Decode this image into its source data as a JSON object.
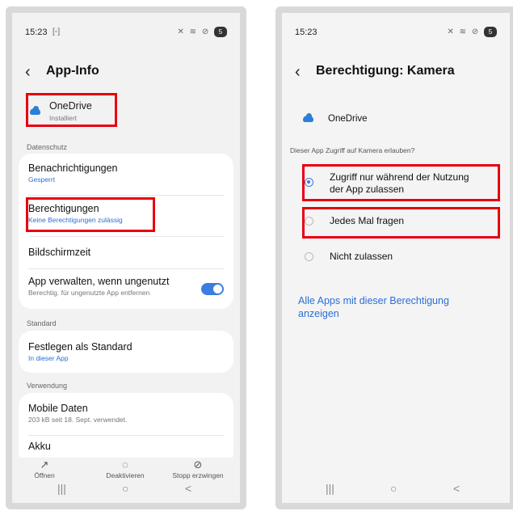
{
  "left": {
    "status": {
      "time": "15:23",
      "notif_icon": "screenshot-icon",
      "right_icons": "✕ ≋ ⊘",
      "battery": "5"
    },
    "header": {
      "title": "App-Info"
    },
    "app": {
      "name": "OneDrive",
      "status": "Installiert"
    },
    "sections": {
      "datenschutz": "Datenschutz",
      "standard": "Standard",
      "verwendung": "Verwendung"
    },
    "rows": {
      "notifications": {
        "title": "Benachrichtigungen",
        "sub": "Gesperrt"
      },
      "permissions": {
        "title": "Berechtigungen",
        "sub": "Keine Berechtigungen zulässig"
      },
      "screen_time": {
        "title": "Bildschirmzeit"
      },
      "manage_unused": {
        "title": "App verwalten, wenn ungenutzt",
        "sub": "Berechtig. für ungenutzte App entfernen"
      },
      "default": {
        "title": "Festlegen als Standard",
        "sub": "In dieser App"
      },
      "mobile_data": {
        "title": "Mobile Daten",
        "sub": "203 kB seit 18. Sept. verwendet."
      },
      "battery": {
        "title": "Akku"
      }
    },
    "actions": [
      {
        "label": "Öffnen",
        "icon": "open-external-icon"
      },
      {
        "label": "Deaktivieren",
        "icon": "disable-icon"
      },
      {
        "label": "Stopp erzwingen",
        "icon": "force-stop-icon"
      }
    ]
  },
  "right": {
    "status": {
      "time": "15:23",
      "right_icons": "✕ ≋ ⊘",
      "battery": "5"
    },
    "header": {
      "title": "Berechtigung: Kamera"
    },
    "app": {
      "name": "OneDrive"
    },
    "question": "Dieser App Zugriff auf Kamera erlauben?",
    "options": [
      {
        "label": "Zugriff nur während der Nutzung der App zulassen",
        "selected": true
      },
      {
        "label": "Jedes Mal fragen",
        "selected": false
      },
      {
        "label": "Nicht zulassen",
        "selected": false
      }
    ],
    "link": "Alle Apps mit dieser Berechtigung anzeigen"
  },
  "nav": {
    "recents": "|||",
    "home": "○",
    "back": "<"
  },
  "colors": {
    "highlight_red": "#e8000f",
    "accent_blue": "#2a6fd6",
    "cloud_blue": "#2a7fd8"
  }
}
